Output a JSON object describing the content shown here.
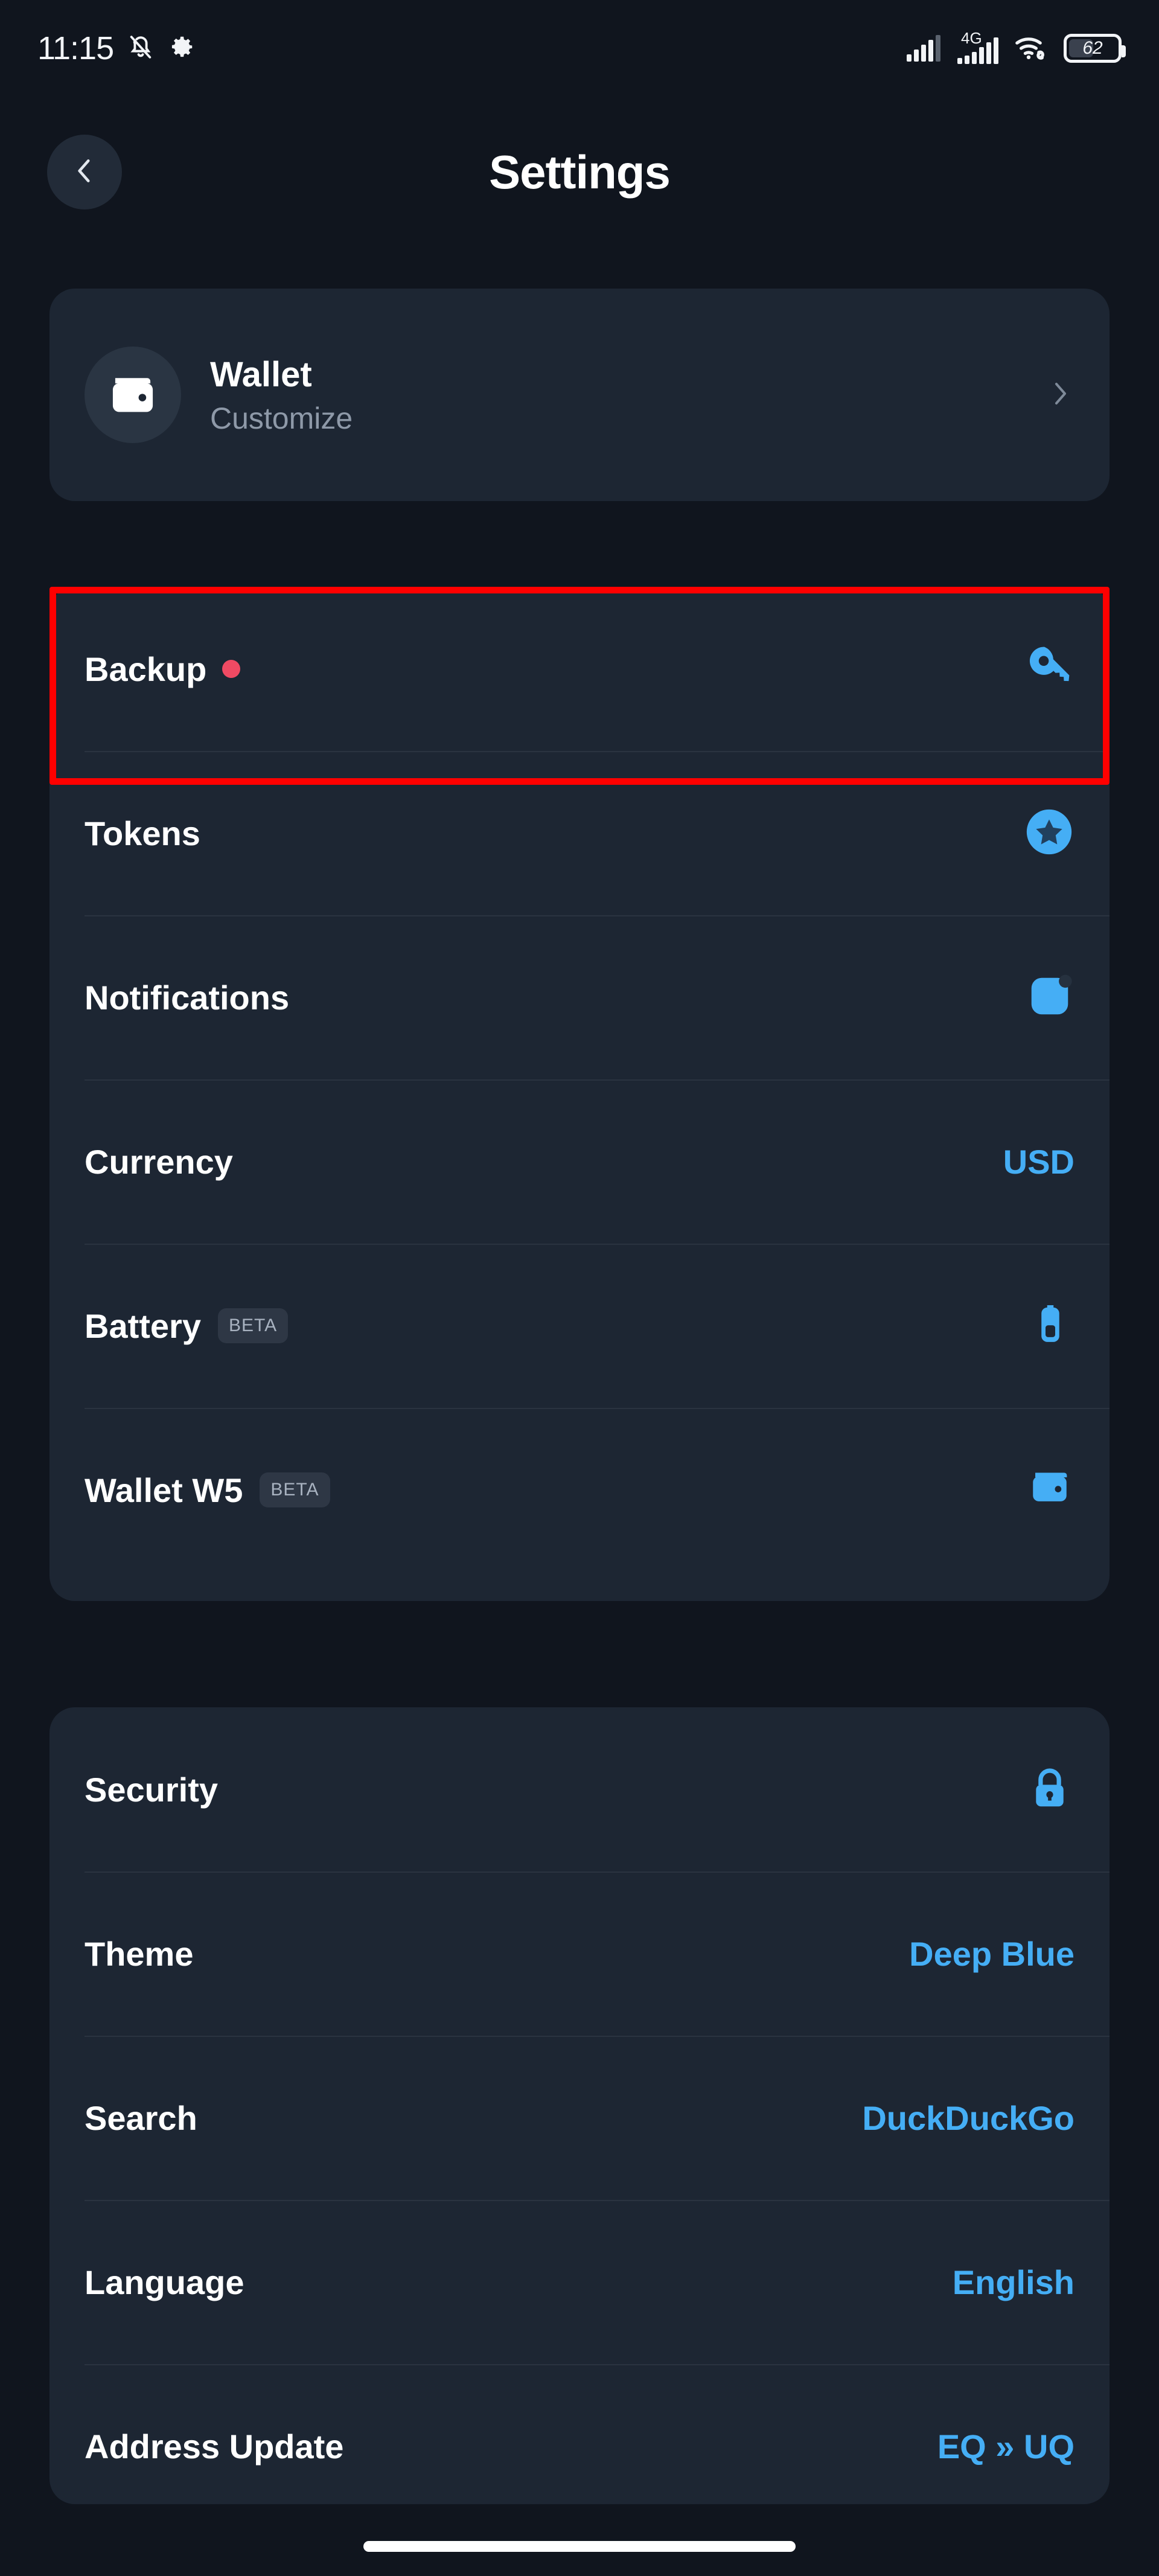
{
  "status_bar": {
    "time": "11:15",
    "left_icons": [
      "bell-muted-icon",
      "gear-icon"
    ],
    "network_label": "4G",
    "right_icons": [
      "signal-bars-icon",
      "signal-bars-4g-icon",
      "wifi-icon"
    ],
    "battery_percent": "62"
  },
  "header": {
    "title": "Settings",
    "back_icon": "chevron-left-icon"
  },
  "wallet_card": {
    "title": "Wallet",
    "subtitle": "Customize",
    "icon": "wallet-icon",
    "chevron": "chevron-right-icon"
  },
  "groups": [
    {
      "id": "group-1",
      "rows": [
        {
          "label": "Backup",
          "badge_dot": true,
          "icon": "key-icon",
          "value": ""
        },
        {
          "label": "Tokens",
          "badge_dot": false,
          "icon": "star-circle-icon",
          "value": ""
        },
        {
          "label": "Notifications",
          "badge_dot": false,
          "icon": "notification-app-icon",
          "value": ""
        },
        {
          "label": "Currency",
          "badge_dot": false,
          "icon": "",
          "value": "USD"
        },
        {
          "label": "Battery",
          "badge_dot": false,
          "icon": "battery-icon",
          "value": "",
          "tag": "BETA"
        },
        {
          "label": "Wallet W5",
          "badge_dot": false,
          "icon": "wallet-small-icon",
          "value": "",
          "tag": "BETA"
        }
      ]
    },
    {
      "id": "group-2",
      "rows": [
        {
          "label": "Security",
          "badge_dot": false,
          "icon": "lock-icon",
          "value": ""
        },
        {
          "label": "Theme",
          "badge_dot": false,
          "icon": "",
          "value": "Deep Blue"
        },
        {
          "label": "Search",
          "badge_dot": false,
          "icon": "",
          "value": "DuckDuckGo"
        },
        {
          "label": "Language",
          "badge_dot": false,
          "icon": "",
          "value": "English"
        },
        {
          "label": "Address Update",
          "badge_dot": false,
          "icon": "",
          "value": "EQ » UQ"
        }
      ]
    }
  ],
  "annotation": {
    "target_row": "Backup",
    "color": "#FF0000"
  },
  "colors": {
    "page_background": "#10151E",
    "card_background": "#1D2633",
    "accent_blue": "#45AEF5",
    "text_primary": "#FFFFFF",
    "text_secondary": "#8E99A8",
    "badge_dot": "#F04A63",
    "divider": "#2A3340"
  }
}
